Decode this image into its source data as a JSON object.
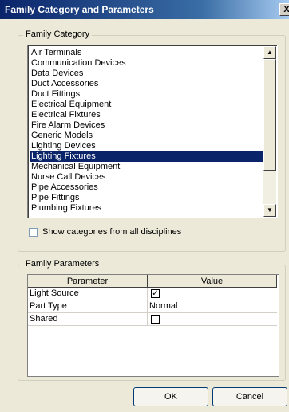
{
  "window": {
    "title": "Family Category and Parameters",
    "close_label": "X"
  },
  "family_category": {
    "legend": "Family Category",
    "items": [
      "Air Terminals",
      "Communication Devices",
      "Data Devices",
      "Duct Accessories",
      "Duct Fittings",
      "Electrical Equipment",
      "Electrical Fixtures",
      "Fire Alarm Devices",
      "Generic Models",
      "Lighting Devices",
      "Lighting Fixtures",
      "Mechanical Equipment",
      "Nurse Call Devices",
      "Pipe Accessories",
      "Pipe Fittings",
      "Plumbing Fixtures"
    ],
    "selected_index": 10,
    "show_all_label": "Show categories from all disciplines",
    "show_all_checked": false
  },
  "family_parameters": {
    "legend": "Family Parameters",
    "columns": [
      "Parameter",
      "Value"
    ],
    "rows": [
      {
        "parameter": "Light Source",
        "value_type": "checkbox",
        "checked": true
      },
      {
        "parameter": "Part Type",
        "value_type": "text",
        "value": "Normal"
      },
      {
        "parameter": "Shared",
        "value_type": "checkbox",
        "checked": false
      }
    ]
  },
  "buttons": {
    "ok": "OK",
    "cancel": "Cancel"
  }
}
